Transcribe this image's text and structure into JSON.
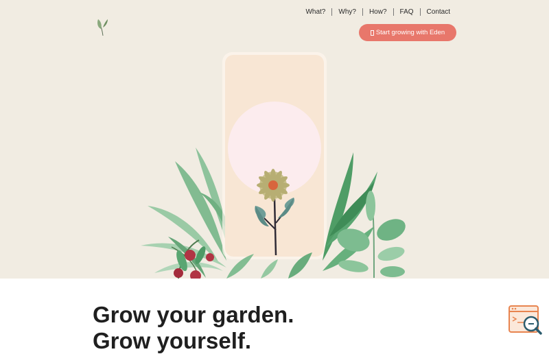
{
  "logo": {
    "icon": "leaf-sprout-icon"
  },
  "nav": {
    "items": [
      {
        "label": "What?"
      },
      {
        "label": "Why?"
      },
      {
        "label": "How?"
      },
      {
        "label": "FAQ"
      },
      {
        "label": "Contact"
      }
    ]
  },
  "cta": {
    "icon": "app-icon",
    "label": "Start growing with Eden"
  },
  "hero": {
    "heading_line1": "Grow your garden.",
    "heading_line2": "Grow yourself."
  },
  "colors": {
    "hero_bg": "#f1ece2",
    "accent": "#e8776b",
    "phone": "#f8e6d4",
    "sun": "#fcecee",
    "leaf": "#5aa672",
    "berry": "#b13444"
  },
  "widget": {
    "icon": "browser-search-icon"
  }
}
